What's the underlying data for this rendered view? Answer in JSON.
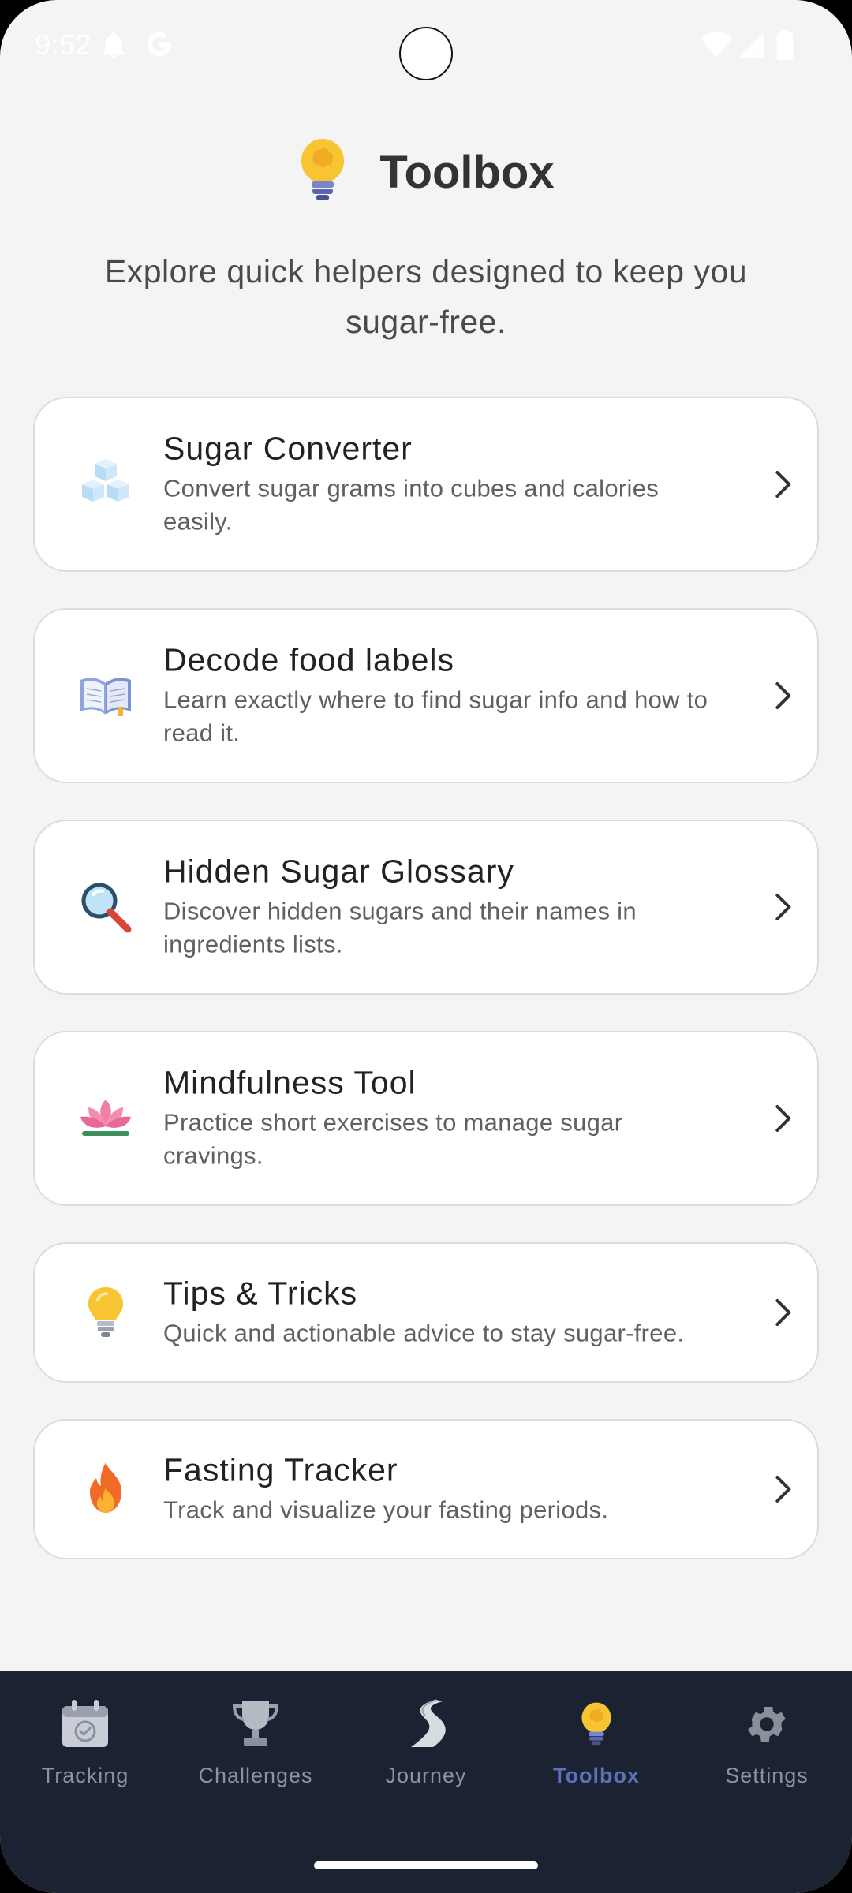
{
  "status_bar": {
    "time": "9:52",
    "icons": [
      "notification-bell-icon",
      "google-icon",
      "wifi-icon",
      "signal-icon",
      "battery-icon"
    ]
  },
  "header": {
    "title": "Toolbox",
    "icon": "lightbulb-brain-icon"
  },
  "subtitle": "Explore quick helpers designed to keep you sugar-free.",
  "tools": [
    {
      "title": "Sugar Converter",
      "description": "Convert sugar grams into cubes and calories easily.",
      "icon": "sugar-cubes-icon"
    },
    {
      "title": "Decode food labels",
      "description": "Learn exactly where to find sugar info and how to read it.",
      "icon": "open-book-icon"
    },
    {
      "title": "Hidden Sugar Glossary",
      "description": "Discover hidden sugars and their names in ingredients lists.",
      "icon": "magnifier-icon"
    },
    {
      "title": "Mindfulness Tool",
      "description": "Practice short exercises to manage sugar cravings.",
      "icon": "lotus-icon"
    },
    {
      "title": "Tips & Tricks",
      "description": "Quick and actionable advice to stay sugar-free.",
      "icon": "lightbulb-icon"
    },
    {
      "title": "Fasting Tracker",
      "description": "Track and visualize your fasting periods.",
      "icon": "fire-icon"
    }
  ],
  "bottom_nav": {
    "items": [
      {
        "label": "Tracking",
        "icon": "calendar-check-icon"
      },
      {
        "label": "Challenges",
        "icon": "trophy-icon"
      },
      {
        "label": "Journey",
        "icon": "winding-road-icon"
      },
      {
        "label": "Toolbox",
        "icon": "lightbulb-brain-icon",
        "active": true
      },
      {
        "label": "Settings",
        "icon": "gear-icon"
      }
    ]
  },
  "colors": {
    "background": "#f4f4f4",
    "nav_background": "#1b2332",
    "nav_active": "#5f6fb8",
    "nav_inactive": "#8c93a0"
  }
}
